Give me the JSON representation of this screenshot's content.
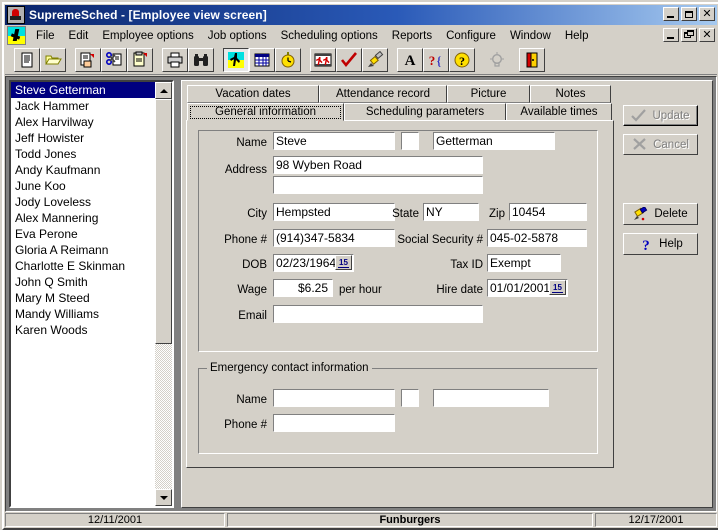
{
  "window": {
    "app_name": "SupremeSched",
    "title": "SupremeSched - [Employee view screen]",
    "min_label": "_",
    "max_label": "□",
    "restore_label": "❐",
    "close_label": "✕"
  },
  "menu": {
    "items": [
      {
        "label": "File"
      },
      {
        "label": "Edit"
      },
      {
        "label": "Employee options"
      },
      {
        "label": "Job options"
      },
      {
        "label": "Scheduling options"
      },
      {
        "label": "Reports"
      },
      {
        "label": "Configure"
      },
      {
        "label": "Window"
      },
      {
        "label": "Help"
      }
    ]
  },
  "toolbar": {
    "buttons": [
      {
        "name": "new-document-button",
        "icon": "document-icon"
      },
      {
        "name": "open-folder-button",
        "icon": "open-folder-icon"
      },
      {
        "name": "cut-employee-button",
        "icon": "document-person-icon"
      },
      {
        "name": "cut-button",
        "icon": "scissors-icon"
      },
      {
        "name": "paste-button",
        "icon": "clipboard-icon"
      },
      {
        "name": "print-button",
        "icon": "printer-icon"
      },
      {
        "name": "find-button",
        "icon": "binoculars-icon"
      },
      {
        "name": "employee-view-button",
        "icon": "running-person-icon"
      },
      {
        "name": "schedule-grid-button",
        "icon": "calendar-grid-icon"
      },
      {
        "name": "time-clock-button",
        "icon": "clock-icon"
      },
      {
        "name": "filmstrip-button",
        "icon": "filmstrip-person-icon"
      },
      {
        "name": "approve-button",
        "icon": "check-mark-icon"
      },
      {
        "name": "paint-button",
        "icon": "paintbrush-icon"
      },
      {
        "name": "font-button",
        "icon": "letter-a-icon"
      },
      {
        "name": "query-button",
        "icon": "question-brace-icon"
      },
      {
        "name": "help-topics-button",
        "icon": "yellow-question-icon"
      },
      {
        "name": "tip-button",
        "icon": "lightbulb-icon"
      },
      {
        "name": "exit-button",
        "icon": "exit-door-icon"
      }
    ]
  },
  "employee_list": {
    "items": [
      "Steve  Getterman",
      "Jack  Hammer",
      "Alex  Harvilway",
      "Jeff  Howister",
      "Todd  Jones",
      "Andy  Kaufmann",
      "June  Koo",
      "Jody  Loveless",
      "Alex  Mannering",
      "Eva  Perone",
      "Gloria A Reimann",
      "Charlotte E Skinman",
      "John Q Smith",
      "Mary M Steed",
      "Mandy  Williams",
      "Karen  Woods"
    ],
    "selected_index": 0
  },
  "tabs": {
    "row_top": [
      {
        "label": "Vacation dates",
        "active": false
      },
      {
        "label": "Attendance record",
        "active": false
      },
      {
        "label": "Picture",
        "active": false
      },
      {
        "label": "Notes",
        "active": false
      }
    ],
    "row_bottom": [
      {
        "label": "General information",
        "active": true
      },
      {
        "label": "Scheduling parameters",
        "active": false
      },
      {
        "label": "Available times",
        "active": false
      }
    ]
  },
  "form": {
    "labels": {
      "name": "Name",
      "address": "Address",
      "city": "City",
      "state": "State",
      "zip": "Zip",
      "phone": "Phone #",
      "ssn": "Social Security #",
      "dob": "DOB",
      "tax_id": "Tax ID",
      "wage": "Wage",
      "per_hour": "per hour",
      "hire_date": "Hire date",
      "email": "Email"
    },
    "values": {
      "first_name": "Steve",
      "middle_initial": "",
      "last_name": "Getterman",
      "address1": "98 Wyben Road",
      "address2": "",
      "city": "Hempsted",
      "state": "NY",
      "zip": "10454",
      "phone": "(914)347-5834",
      "ssn": "045-02-5878",
      "dob": "02/23/1964",
      "tax_id": "Exempt",
      "wage": "$6.25",
      "hire_date": "01/01/2001",
      "email": ""
    },
    "calendar_button_label": "15"
  },
  "emergency": {
    "title": "Emergency contact information",
    "labels": {
      "name": "Name",
      "phone": "Phone #"
    },
    "values": {
      "first_name": "",
      "middle_initial": "",
      "last_name": "",
      "phone": ""
    }
  },
  "actions": {
    "update": {
      "label": "Update",
      "enabled": false,
      "icon": "check-pencil-icon"
    },
    "cancel": {
      "label": "Cancel",
      "enabled": false,
      "icon": "x-erase-icon"
    },
    "delete": {
      "label": "Delete",
      "enabled": true,
      "icon": "eraser-icon"
    },
    "help": {
      "label": "Help",
      "enabled": true,
      "icon": "question-mark-icon"
    }
  },
  "statusbar": {
    "left": "12/11/2001",
    "center": "Funburgers",
    "right": "12/17/2001"
  },
  "colors": {
    "face": "#d4d0c8",
    "title_active": "#0a246a",
    "selection": "#000080",
    "field_bg": "#ffffff",
    "disabled_text": "#808080"
  }
}
